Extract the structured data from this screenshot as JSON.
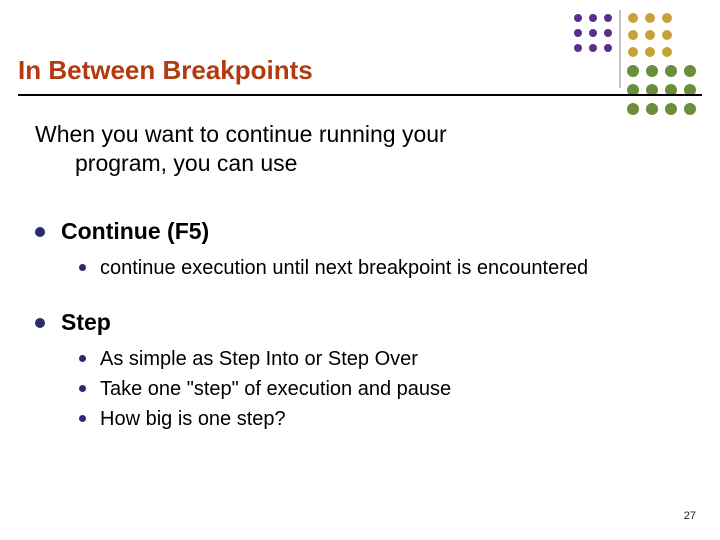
{
  "title": "In Between Breakpoints",
  "intro_line1": "When you want to continue running your",
  "intro_line2": "program, you can use",
  "sections": [
    {
      "heading": "Continue (F5)",
      "items": [
        "continue execution until next breakpoint is encountered"
      ]
    },
    {
      "heading": "Step",
      "items": [
        "As simple as Step Into or Step Over",
        "Take one \"step\" of execution and pause",
        "How big is one step?"
      ]
    }
  ],
  "slide_number": "27"
}
